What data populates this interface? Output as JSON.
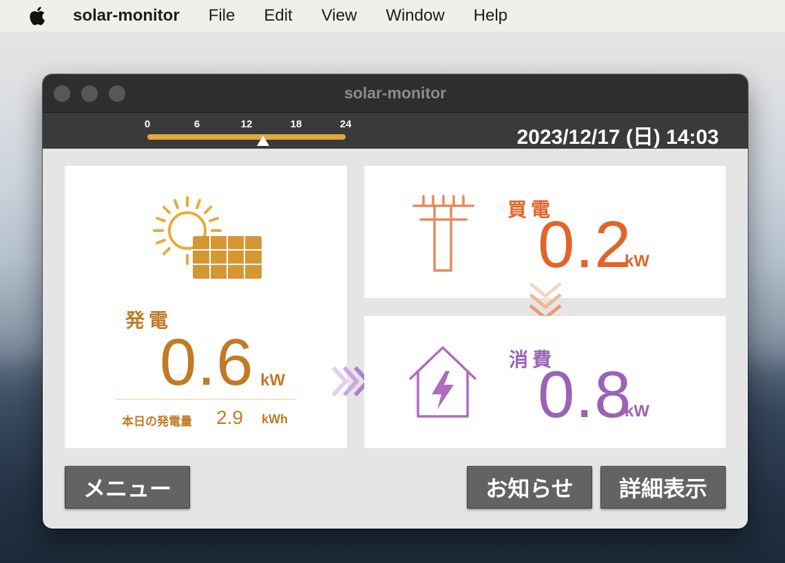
{
  "menubar": {
    "app_name": "solar-monitor",
    "items": [
      "File",
      "Edit",
      "View",
      "Window",
      "Help"
    ]
  },
  "window": {
    "title": "solar-monitor"
  },
  "status": {
    "hour_ticks": [
      "0",
      "6",
      "12",
      "18",
      "24"
    ],
    "current_time_fraction": 0.585,
    "datetime": "2023/12/17 (日) 14:03"
  },
  "generation": {
    "label": "発電",
    "value": "0.6",
    "unit": "kW",
    "today_label": "本日の発電量",
    "today_value": "2.9",
    "today_unit": "kWh",
    "icon": "solar-panel-icon"
  },
  "purchase": {
    "label": "買電",
    "value": "0.2",
    "unit": "kW",
    "icon": "power-pole-icon"
  },
  "consumption": {
    "label": "消費",
    "value": "0.8",
    "unit": "kW",
    "icon": "house-power-icon"
  },
  "buttons": {
    "menu": "メニュー",
    "news": "お知らせ",
    "details": "詳細表示"
  },
  "colors": {
    "generation": "#c07b25",
    "purchase": "#e0652a",
    "consumption": "#9a63b6",
    "timebar": "#e0a93c"
  }
}
